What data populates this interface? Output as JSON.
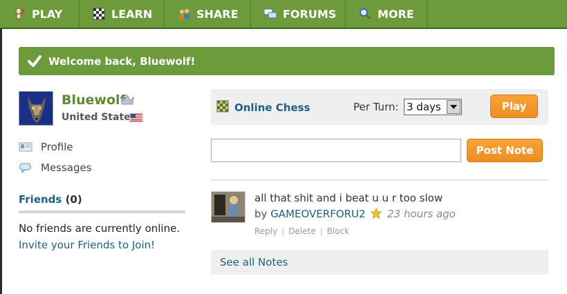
{
  "nav": {
    "items": [
      {
        "label": "PLAY",
        "icon": "pawn-question-icon"
      },
      {
        "label": "LEARN",
        "icon": "board-icon"
      },
      {
        "label": "SHARE",
        "icon": "people-icon"
      },
      {
        "label": "FORUMS",
        "icon": "speech-bubbles-icon"
      },
      {
        "label": "MORE",
        "icon": "magnifier-icon"
      }
    ]
  },
  "welcome": {
    "message": "Welcome back, Bluewolf!"
  },
  "user": {
    "name": "Bluewolf",
    "country": "United States"
  },
  "sidebar": {
    "links": [
      {
        "label": "Profile"
      },
      {
        "label": "Messages"
      }
    ],
    "friends": {
      "title": "Friends",
      "count_text": "(0)",
      "empty_text": "No friends are currently online.",
      "invite_text": "Invite your Friends to Join!"
    }
  },
  "chess": {
    "label": "Online Chess",
    "per_turn_label": "Per Turn:",
    "per_turn_value": "3 days",
    "play_label": "Play"
  },
  "notes": {
    "post_label": "Post Note",
    "input_value": "",
    "items": [
      {
        "text": "all that shit and i beat u u r too slow",
        "by": "by",
        "author": "GAMEOVERFORU2",
        "time": "23 hours ago",
        "actions": [
          "Reply",
          "Delete",
          "Block"
        ]
      }
    ],
    "see_all": "See all Notes"
  },
  "colors": {
    "nav_green": "#6d9a3b",
    "link_blue": "#1f5e86",
    "button_orange": "#ef8d1e"
  }
}
